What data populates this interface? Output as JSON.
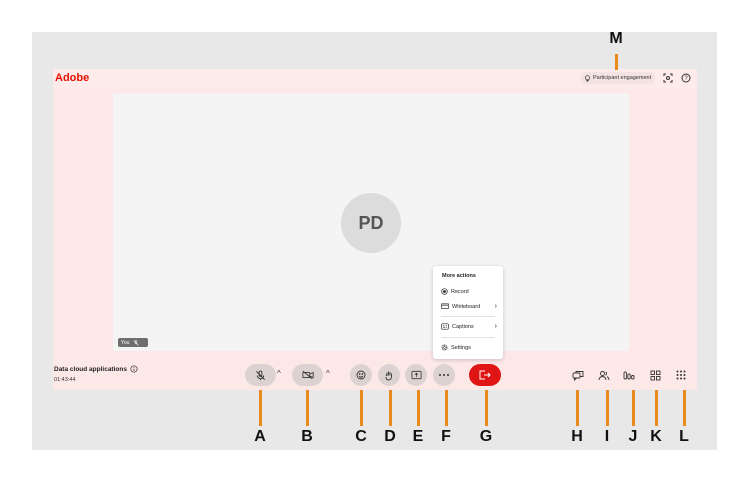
{
  "app": {
    "logo": "Adobe"
  },
  "header": {
    "engagement_label": "Participant engagement",
    "icons": [
      "lightbulb-icon",
      "focus-icon",
      "help-icon"
    ]
  },
  "stage": {
    "avatar_initials": "PD",
    "self_label": "You"
  },
  "more_actions": {
    "title": "More actions",
    "items": [
      {
        "label": "Record",
        "icon": "record-icon"
      },
      {
        "label": "Whiteboard",
        "icon": "whiteboard-icon",
        "has_submenu": true
      },
      {
        "label": "Captions",
        "icon": "captions-icon",
        "has_submenu": true
      },
      {
        "label": "Settings",
        "icon": "settings-icon"
      }
    ]
  },
  "meeting": {
    "title": "Data cloud applications",
    "time": "01:43:44"
  },
  "controls": [
    "mic-muted-icon",
    "camera-off-icon",
    "emoji-icon",
    "raise-hand-icon",
    "share-screen-icon",
    "more-icon",
    "leave-icon"
  ],
  "right_controls": [
    "chat-icon",
    "people-icon",
    "poll-icon",
    "apps-icon",
    "grid-icon"
  ],
  "callouts": {
    "A": "A",
    "B": "B",
    "C": "C",
    "D": "D",
    "E": "E",
    "F": "F",
    "G": "G",
    "H": "H",
    "I": "I",
    "J": "J",
    "K": "K",
    "L": "L",
    "M": "M"
  },
  "colors": {
    "brand": "#eb1000",
    "leave": "#e01515",
    "callout_line": "#e98a1f",
    "app_bg": "#fde8e8"
  }
}
